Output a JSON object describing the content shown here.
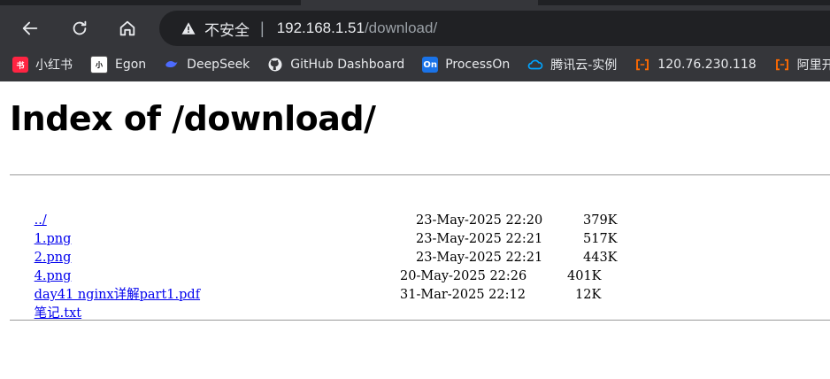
{
  "browser": {
    "security_label": "不安全",
    "url_host": "192.168.1.51",
    "url_path": "/download/",
    "bookmarks": [
      {
        "label": "小红书",
        "icon": "xiaohongshu-icon",
        "color": "#ff2442"
      },
      {
        "label": "Egon",
        "icon": "egon-icon",
        "color": "#ffffff"
      },
      {
        "label": "DeepSeek",
        "icon": "deepseek-icon",
        "color": "#4d6bfe"
      },
      {
        "label": "GitHub Dashboard",
        "icon": "github-icon",
        "color": "#ffffff"
      },
      {
        "label": "ProcessOn",
        "icon": "processon-icon",
        "color": "#1a73e8"
      },
      {
        "label": "腾讯云-实例",
        "icon": "tencent-cloud-icon",
        "color": "#00a4ff"
      },
      {
        "label": "120.76.230.118",
        "icon": "aliyun-icon",
        "color": "#ff6a00"
      },
      {
        "label": "阿里开",
        "icon": "aliyun-icon",
        "color": "#ff6a00"
      }
    ]
  },
  "page": {
    "title": "Index of /download/",
    "entries": [
      {
        "name": "../",
        "date": "",
        "size": ""
      },
      {
        "name": "1.png",
        "date": "23-May-2025 22:20",
        "size": "379K"
      },
      {
        "name": "2.png",
        "date": "23-May-2025 22:21",
        "size": "517K"
      },
      {
        "name": "4.png",
        "date": "23-May-2025 22:21",
        "size": "443K"
      },
      {
        "name": "day41 nginx详解part1.pdf",
        "date": "20-May-2025 22:26",
        "size": "401K"
      },
      {
        "name": "笔记.txt",
        "date": "31-Mar-2025 22:12",
        "size": "12K"
      }
    ]
  }
}
